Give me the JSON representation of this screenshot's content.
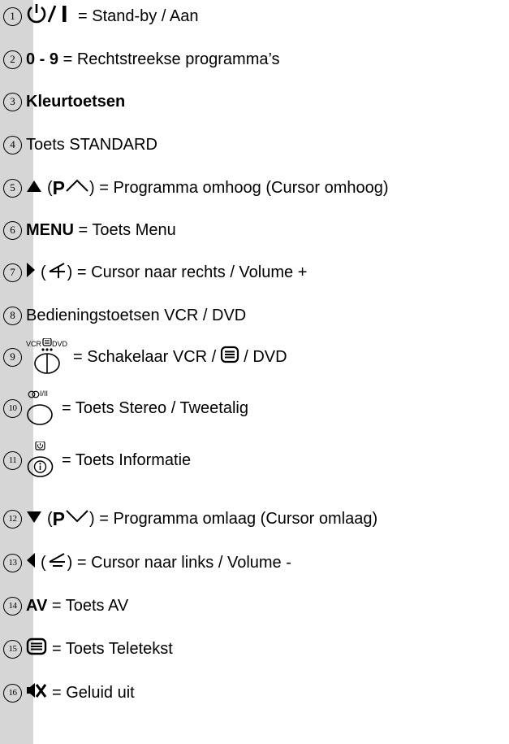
{
  "items": [
    {
      "num": "1",
      "label": "= Stand-by / Aan",
      "icon": "power-icon"
    },
    {
      "num": "2",
      "bold": "0 - 9",
      "label": "= Rechtstreekse programma’s"
    },
    {
      "num": "3",
      "bold": "Kleurtoetsen"
    },
    {
      "num": "4",
      "label": "Toets STANDARD"
    },
    {
      "num": "5",
      "open": "(",
      "pletter": "P",
      "close": ")",
      "label": "= Programma omhoog (Cursor omhoog)",
      "icon": "triangle-up-icon"
    },
    {
      "num": "6",
      "bold": "MENU",
      "label": "= Toets Menu"
    },
    {
      "num": "7",
      "open": "(",
      "close": ")",
      "label": "= Cursor naar rechts / Volume +",
      "icon": "triangle-right-icon"
    },
    {
      "num": "8",
      "label": "Bedieningstoetsen VCR / DVD"
    },
    {
      "num": "9",
      "label": "= Schakelaar VCR /",
      "label2": "/ DVD",
      "sw_vcr": "VCR",
      "sw_dvd": "DVD",
      "icon": "vcr-dvd-switch-icon"
    },
    {
      "num": "10",
      "label": "= Toets Stereo / Tweetalig",
      "sublabel": "I/II",
      "icon": "stereo-button-icon"
    },
    {
      "num": "11",
      "label": "= Toets Informatie",
      "icon": "info-button-icon"
    },
    {
      "num": "12",
      "open": "(",
      "pletter": "P",
      "close": ")",
      "label": "= Programma omlaag (Cursor omlaag)",
      "icon": "triangle-down-icon"
    },
    {
      "num": "13",
      "open": "(",
      "close": ")",
      "label": "= Cursor naar links / Volume -",
      "icon": "triangle-left-icon"
    },
    {
      "num": "14",
      "bold": "AV",
      "label": "= Toets AV"
    },
    {
      "num": "15",
      "label": "= Toets Teletekst",
      "icon": "teletext-icon"
    },
    {
      "num": "16",
      "label": "= Geluid uit",
      "icon": "mute-icon"
    }
  ]
}
